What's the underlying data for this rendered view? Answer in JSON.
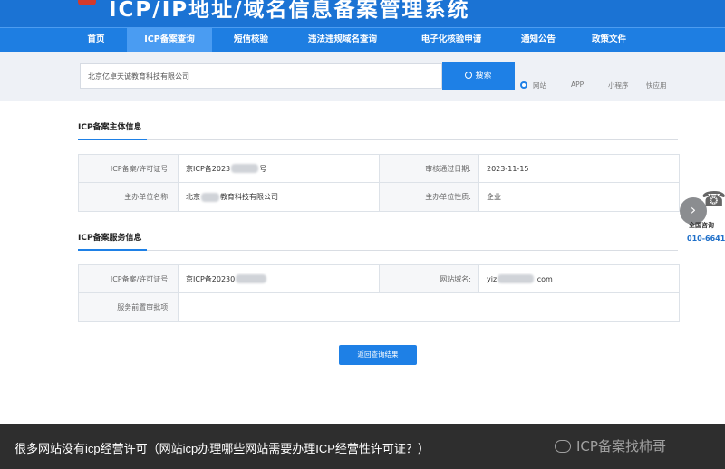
{
  "banner": {
    "title": "ICP/IP地址/域名信息备案管理系统"
  },
  "nav": {
    "items": [
      {
        "label": "首页"
      },
      {
        "label": "ICP备案查询"
      },
      {
        "label": "短信核验"
      },
      {
        "label": "违法违规域名查询"
      },
      {
        "label": "电子化核验申请"
      },
      {
        "label": "通知公告"
      },
      {
        "label": "政策文件"
      }
    ],
    "active_index": 1
  },
  "search": {
    "value": "北京亿卓天诚教育科技有限公司",
    "button_label": "搜索",
    "types": [
      "网站",
      "APP",
      "小程序",
      "快应用"
    ],
    "selected_type": "网站"
  },
  "subject_section": {
    "title": "ICP备案主体信息",
    "rows": [
      [
        {
          "label": "ICP备案/许可证号:",
          "value": "京ICP备2023",
          "value_suffix": "号"
        },
        {
          "label": "审核通过日期:",
          "value": "2023-11-15"
        }
      ],
      [
        {
          "label": "主办单位名称:",
          "value": "北京",
          "value_suffix": "教育科技有限公司"
        },
        {
          "label": "主办单位性质:",
          "value": "企业"
        }
      ]
    ]
  },
  "service_section": {
    "title": "ICP备案服务信息",
    "rows": [
      [
        {
          "label": "ICP备案/许可证号:",
          "value": "京ICP备20230"
        },
        {
          "label": "网站域名:",
          "value": "yiz",
          "value_suffix": ".com"
        }
      ],
      [
        {
          "label": "服务前置审批项:",
          "value": ""
        }
      ]
    ]
  },
  "return_button_label": "返回查询结果",
  "side": {
    "consult_label": "全国咨询",
    "consult_phone": "010-6641"
  },
  "caption": {
    "text": "很多网站没有icp经营许可（网站icp办理哪些网站需要办理ICP经营性许可证？）",
    "watermark": "ICP备案找柿哥"
  },
  "colors": {
    "primary": "#1e80e6",
    "caption_bg": "#2e2e2e"
  }
}
